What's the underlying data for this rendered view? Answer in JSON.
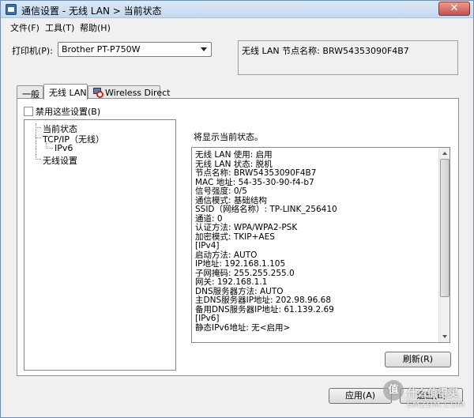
{
  "window": {
    "title": "通信设置 - 无线 LAN > 当前状态",
    "close_symbol": "✕"
  },
  "menu": [
    {
      "label": "文件(F)"
    },
    {
      "label": "工具(T)"
    },
    {
      "label": "帮助(H)"
    }
  ],
  "printer": {
    "label": "打印机(P):",
    "selected": "Brother PT-P750W"
  },
  "node_name": "无线 LAN 节点名称: BRW54353090F4B7",
  "tabs": [
    {
      "label": "一般",
      "active": false
    },
    {
      "label": "无线 LAN",
      "active": true
    },
    {
      "label": "Wireless Direct",
      "active": false,
      "icon": "disabled-network-icon"
    }
  ],
  "disable_checkbox": {
    "label": "禁用这些设置(B)",
    "checked": false
  },
  "tree": {
    "items": [
      {
        "label": "当前状态"
      },
      {
        "label": "TCP/IP（无线）"
      },
      {
        "label": "IPv6"
      },
      {
        "label": "无线设置"
      }
    ]
  },
  "status": {
    "heading": "将显示当前状态。",
    "lines": [
      "无线 LAN 使用: 启用",
      "无线 LAN 状态: 脱机",
      "节点名称: BRW54353090F4B7",
      "MAC 地址: 54-35-30-90-f4-b7",
      "信号强度: 0/5",
      "通信模式: 基础结构",
      "SSID（网络名称）: TP-LINK_256410",
      "通道: 0",
      "认证方法: WPA/WPA2-PSK",
      "加密模式: TKIP+AES",
      "[IPv4]",
      "启动方法: AUTO",
      "IP地址: 192.168.1.105",
      "子网掩码: 255.255.255.0",
      "网关: 192.168.1.1",
      "DNS服务器方法: AUTO",
      "主DNS服务器IP地址: 202.98.96.68",
      "备用DNS服务器IP地址: 61.139.2.69",
      "[IPv6]",
      "静态IPv6地址: 无<启用>"
    ]
  },
  "buttons": {
    "refresh": "刷新(R)",
    "apply": "应用(A)",
    "exit": "退出(E)"
  },
  "watermark": {
    "mark": "值",
    "text": "什么值得买",
    "sub": "SMZDM.COM"
  }
}
